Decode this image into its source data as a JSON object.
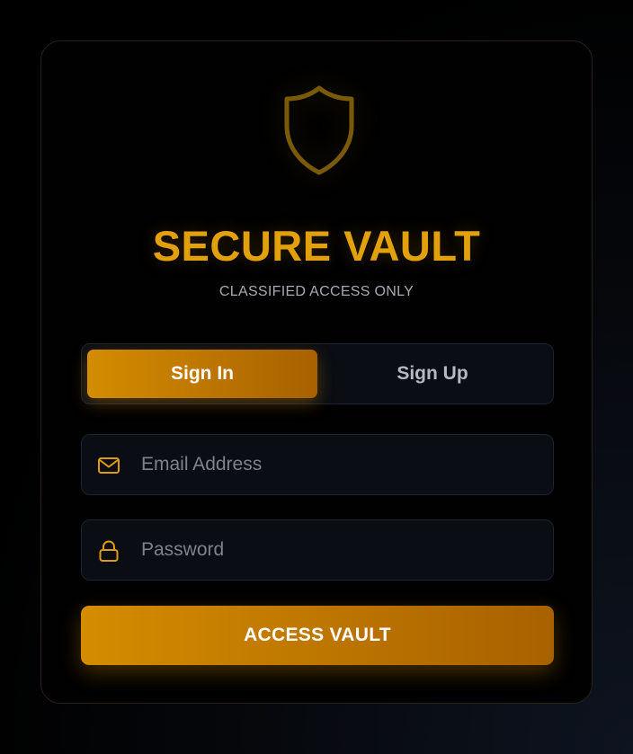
{
  "brand": {
    "title": "SECURE VAULT",
    "subtitle": "CLASSIFIED ACCESS ONLY",
    "logo_icon": "shield-icon"
  },
  "tabs": [
    {
      "label": "Sign In",
      "active": true
    },
    {
      "label": "Sign Up",
      "active": false
    }
  ],
  "form": {
    "email": {
      "placeholder": "Email Address",
      "value": "",
      "icon": "mail-icon"
    },
    "password": {
      "placeholder": "Password",
      "value": "",
      "icon": "lock-icon"
    },
    "submit_label": "ACCESS VAULT"
  },
  "colors": {
    "accent": "#e2a10b",
    "button_gradient_start": "#d48c00",
    "button_gradient_end": "#a86100",
    "background": "#000000",
    "field_background": "#0a0d13"
  }
}
